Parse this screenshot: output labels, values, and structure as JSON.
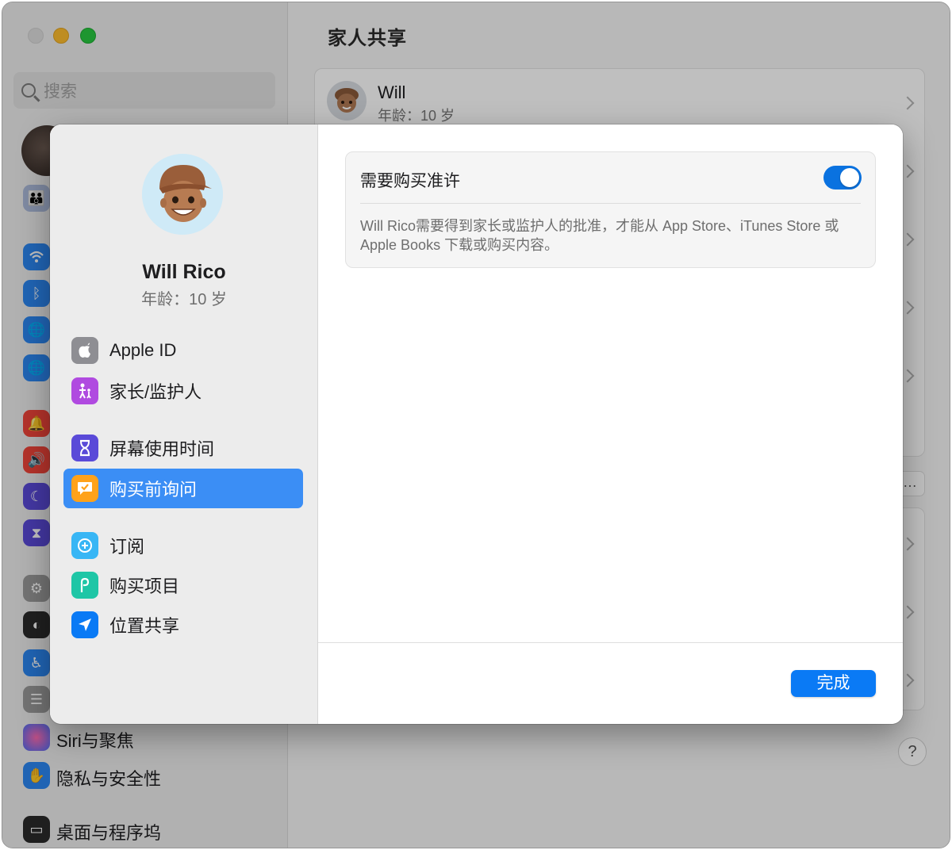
{
  "background": {
    "window_title": "家人共享",
    "search_placeholder": "搜索",
    "member": {
      "name": "Will",
      "age": "年龄：10 岁"
    },
    "more_button": "…",
    "help_button": "?",
    "sidebar_items": [
      {
        "label": "Siri与聚焦",
        "icon": "siri-icon"
      },
      {
        "label": "隐私与安全性",
        "icon": "hand-icon"
      },
      {
        "label": "桌面与程序坞",
        "icon": "dock-icon"
      }
    ]
  },
  "sheet": {
    "profile": {
      "name": "Will Rico",
      "age": "年龄：10 岁"
    },
    "nav": [
      {
        "label": "Apple ID",
        "icon": "apple-icon",
        "color": "#8e8e93"
      },
      {
        "label": "家长/监护人",
        "icon": "family-icon",
        "color": "#b04ae0"
      },
      {
        "label": "屏幕使用时间",
        "icon": "hourglass-icon",
        "color": "#5a4ad8"
      },
      {
        "label": "购买前询问",
        "icon": "ask-to-buy-icon",
        "color": "#ffa21a",
        "selected": true
      },
      {
        "label": "订阅",
        "icon": "subscription-icon",
        "color": "#38b6f5"
      },
      {
        "label": "购买项目",
        "icon": "purchases-icon",
        "color": "#1fc6a6"
      },
      {
        "label": "位置共享",
        "icon": "location-icon",
        "color": "#0a7af5"
      }
    ],
    "setting": {
      "title": "需要购买准许",
      "enabled": true,
      "description": "Will Rico需要得到家长或监护人的批准，才能从 App Store、iTunes Store 或 Apple Books 下载或购买内容。"
    },
    "done_label": "完成"
  },
  "colors": {
    "accent": "#0a7af5",
    "selection": "#3b8ef5"
  }
}
